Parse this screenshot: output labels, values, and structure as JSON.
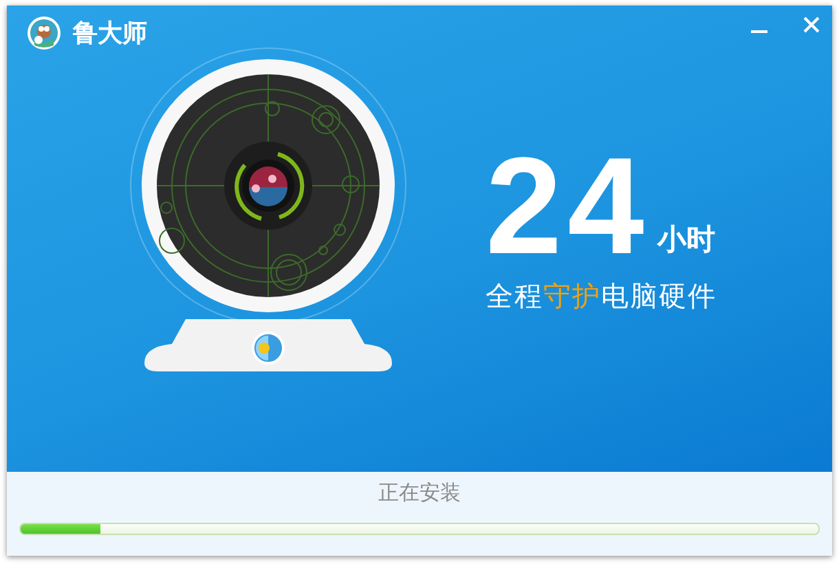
{
  "window": {
    "title": "鲁大师"
  },
  "banner": {
    "number": "24",
    "unit": "小时",
    "subtitle": [
      {
        "text": "全程",
        "highlight": false
      },
      {
        "text": "守护",
        "highlight": true
      },
      {
        "text": "电脑硬件",
        "highlight": false
      }
    ]
  },
  "status": {
    "text": "正在安装",
    "level": 0.1
  }
}
